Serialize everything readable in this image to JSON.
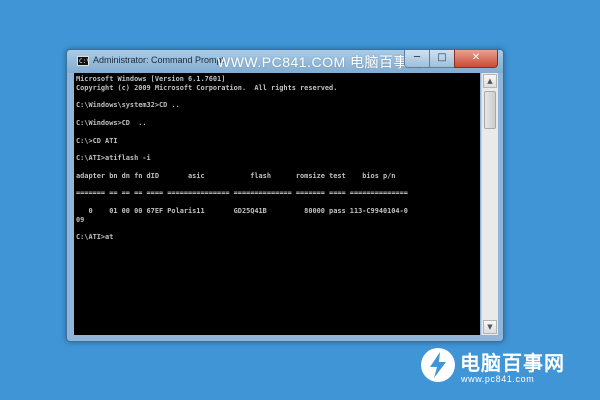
{
  "window": {
    "title": "Administrator: Command Prompt",
    "icon_text": "C:\\",
    "buttons": {
      "minimize": "─",
      "maximize": "□",
      "close": "✕"
    }
  },
  "watermark_top": "WWW.PC841.COM 电脑百事网",
  "console": {
    "lines": [
      "Microsoft Windows [Version 6.1.7601]",
      "Copyright (c) 2009 Microsoft Corporation.  All rights reserved.",
      "",
      "C:\\Windows\\system32>CD ..",
      "",
      "C:\\Windows>CD  ..",
      "",
      "C:\\>CD ATI",
      "",
      "C:\\ATI>atiflash -i",
      "",
      "adapter bn dn fn dID       asic           flash      romsize test    bios p/n",
      "",
      "======= == == == ==== =============== ============== ======= ==== ==============",
      "",
      "   0    01 00 00 67EF Polaris11       GD25Q41B         80000 pass 113-C9940104-0",
      "09",
      "",
      "C:\\ATI>at"
    ]
  },
  "scrollbar": {
    "up_glyph": "▲",
    "down_glyph": "▼"
  },
  "logo": {
    "name": "电脑百事网",
    "url": "www.pc841.com",
    "colors": {
      "mark": "#ffffff",
      "accent": "#3f95d6"
    }
  }
}
